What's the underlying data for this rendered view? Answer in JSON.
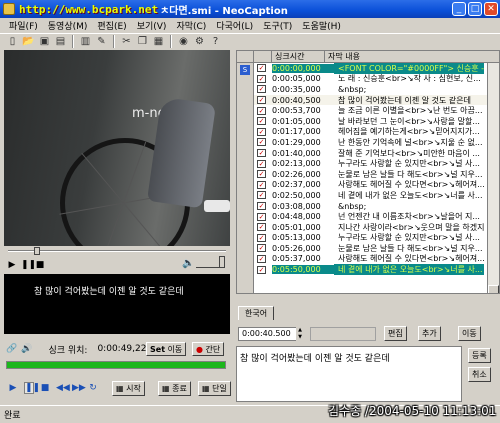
{
  "window": {
    "url_overlay": "http://www.bcpark.net",
    "title": "ㅊ다면.smi - NeoCaption",
    "colors": {
      "titlebar": "#0a4fd8",
      "selection": "#0a8a8a",
      "selection_text": "#d8ff4a"
    }
  },
  "menu": [
    "파일(F)",
    "동영상(M)",
    "편집(E)",
    "보기(V)",
    "자막(C)",
    "다국어(L)",
    "도구(T)",
    "도움말(H)"
  ],
  "toolbar_icons": [
    "new-file-icon",
    "open-folder-icon",
    "save-icon",
    "save-as-icon",
    "export-icon",
    "edit-icon",
    "cut-icon",
    "copy-icon",
    "paste-icon",
    "search-icon",
    "settings-icon",
    "help-icon"
  ],
  "video": {
    "logo_text": "m-net"
  },
  "subtitle_display": "참 많이 걱어봤는데 이젠 알 것도 같은데",
  "list": {
    "headers": [
      "싱크시간",
      "자막 내용"
    ],
    "rows": [
      {
        "time": "0:00:00,000",
        "text": "<FONT COLOR=\"#0000FF\"> 신승훈 - 사...",
        "selected": true
      },
      {
        "time": "0:00:05,000",
        "text": "노 래 : 신승훈<br>↘작 사 : 심현보, 신...",
        "selected": false
      },
      {
        "time": "0:00:35,000",
        "text": "&nbsp;",
        "selected": false
      },
      {
        "time": "0:00:40,500",
        "text": "참 많이 걱어봤는데 이젠 알 것도 같은데",
        "selected": false,
        "current": true
      },
      {
        "time": "0:00:53,700",
        "text": "늘 조금 이른 이별을<br>↘난 번도 아끔...",
        "selected": false
      },
      {
        "time": "0:01:05,000",
        "text": "날 바라보던 그 눈이<br>↘사랑을 말할...",
        "selected": false
      },
      {
        "time": "0:01:17,000",
        "text": "헤어짐을 예기하는게<br>↘믿어지지가...",
        "selected": false
      },
      {
        "time": "0:01:29,000",
        "text": "난 한동안 기억속에 널<br>↘지울 순 없...",
        "selected": false
      },
      {
        "time": "0:01:40,000",
        "text": "잘해 준 기억보다<br>↘미안한 마음이 ...",
        "selected": false
      },
      {
        "time": "0:02:13,000",
        "text": "누구라도 사랑할 순 있지만<br>↘널 사...",
        "selected": false
      },
      {
        "time": "0:02:26,000",
        "text": "눈물로 남은 날들 다 해도<br>↘널 지우...",
        "selected": false
      },
      {
        "time": "0:02:37,000",
        "text": "사랑해도 헤어질 수 있다면<br>↘헤어져...",
        "selected": false
      },
      {
        "time": "0:02:50,000",
        "text": "네 곁에 내가 없은 오늘도<br>↘너를 사...",
        "selected": false
      },
      {
        "time": "0:03:08,000",
        "text": "&nbsp;",
        "selected": false
      },
      {
        "time": "0:04:48,000",
        "text": "넌 언젠간 내 이름조차<br>↘날을어 지...",
        "selected": false
      },
      {
        "time": "0:05:01,000",
        "text": "지나간 사랑이라<br>↘웃으며 말을 하겠지",
        "selected": false
      },
      {
        "time": "0:05:13,000",
        "text": "누구라도 사랑할 순 있지만<br>↘널 사...",
        "selected": false
      },
      {
        "time": "0:05:26,000",
        "text": "눈물로 남은 날들 다 해도<br>↘널 지우...",
        "selected": false
      },
      {
        "time": "0:05:37,000",
        "text": "사랑해도 헤어질 수 있다면<br>↘헤어져...",
        "selected": false
      },
      {
        "time": "0:05:50,000",
        "text": "네 곁에 내가 없은 오늘도<br>↘너를 사...",
        "selected": true
      }
    ]
  },
  "tab_label": "한국어",
  "edit": {
    "time_value": "0:00:40.500",
    "edit_button": "편집",
    "add_button": "추가",
    "move_button": "이동",
    "text": "참 많이 걱어봤는데 이젠 알 것도 같은데",
    "register_button": "등록",
    "cancel_button": "취소"
  },
  "sync": {
    "label": "싱크 위치:",
    "value": "0:00:49,228",
    "move_button": "이동",
    "move_prefix": "Set",
    "cancel_button": "간단",
    "progress_pct": 100
  },
  "playback": {
    "start_button": "시작",
    "end_button": "종료",
    "single_button": "단일"
  },
  "status_text": "완료",
  "watermark": "김수종 /2004-05-10 11:13:01"
}
